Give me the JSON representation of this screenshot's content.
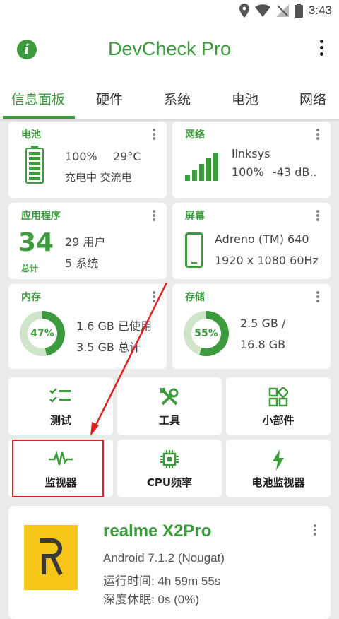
{
  "status_bar": {
    "time": "3:43",
    "icons": [
      "location-icon",
      "wifi-icon",
      "no-signal-icon",
      "battery-icon"
    ]
  },
  "app_bar": {
    "title": "DevCheck Pro",
    "info_icon": "i"
  },
  "tabs": [
    "信息面板",
    "硬件",
    "系统",
    "电池",
    "网络"
  ],
  "cards": {
    "battery": {
      "title": "电池",
      "level": "100%",
      "temp": "29°C",
      "status": "充电中 交流电"
    },
    "network": {
      "title": "网络",
      "ssid": "linksys",
      "strength": "100%",
      "dbm": "-43 dB.."
    },
    "apps": {
      "title": "应用程序",
      "total": "34",
      "total_label": "总计",
      "user": "29 用户",
      "system": "5 系统"
    },
    "screen": {
      "title": "屏幕",
      "gpu": "Adreno (TM) 640",
      "resolution": "1920 x 1080  60Hz"
    },
    "memory": {
      "title": "内存",
      "percent_label": "47%",
      "percent": 47,
      "used": "1.6 GB 已使用",
      "total": "3.5 GB 总计"
    },
    "storage": {
      "title": "存储",
      "percent_label": "55%",
      "percent": 55,
      "used": "2.5 GB /",
      "total": "16.8 GB"
    }
  },
  "tools": [
    {
      "label": "测试",
      "icon": "checklist-icon"
    },
    {
      "label": "工具",
      "icon": "tools-icon"
    },
    {
      "label": "小部件",
      "icon": "widgets-icon"
    },
    {
      "label": "监视器",
      "icon": "pulse-icon"
    },
    {
      "label": "CPU频率",
      "icon": "cpu-icon"
    },
    {
      "label": "电池监视器",
      "icon": "bolt-icon"
    }
  ],
  "device": {
    "name": "realme X2Pro",
    "android": "Android 7.1.2 (Nougat)",
    "uptime": "运行时间: 4h 59m 55s",
    "deep_sleep": "深度休眠: 0s (0%)"
  },
  "colors": {
    "accent": "#3d9a3d",
    "annotation": "#e02020",
    "logo_bg": "#f5c518"
  }
}
